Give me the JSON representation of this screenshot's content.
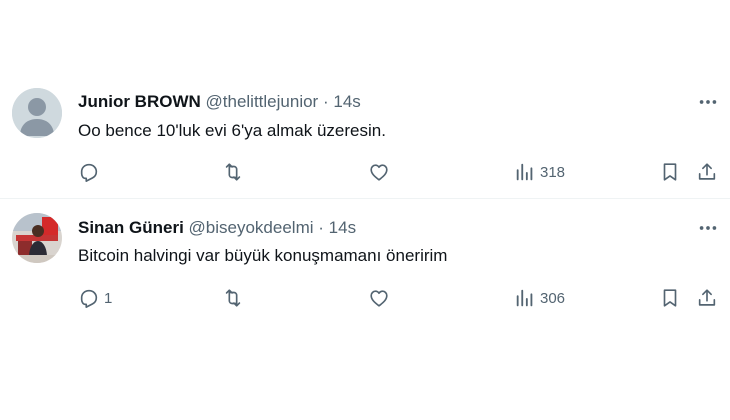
{
  "replies": [
    {
      "display_name": "Junior BROWN",
      "handle": "@thelittlejunior",
      "separator": "·",
      "time": "14s",
      "text": "Oo bence 10'luk evi 6'ya almak üzeresin.",
      "avatar": "default-avatar",
      "reply_count": "",
      "views": "318"
    },
    {
      "display_name": "Sinan Güneri",
      "handle": "@biseyokdeelmi",
      "separator": "·",
      "time": "14s",
      "text": "Bitcoin halvingi var büyük konuşmamanı öneririm",
      "avatar": "photo-avatar",
      "reply_count": "1",
      "views": "306"
    }
  ],
  "colors": {
    "text_primary": "#0f1419",
    "text_secondary": "#536471",
    "divider": "#eff3f4",
    "avatar_placeholder": "#cfd9de"
  },
  "icons": [
    "reply-icon",
    "retweet-icon",
    "like-icon",
    "views-icon",
    "bookmark-icon",
    "share-icon",
    "more-icon"
  ]
}
